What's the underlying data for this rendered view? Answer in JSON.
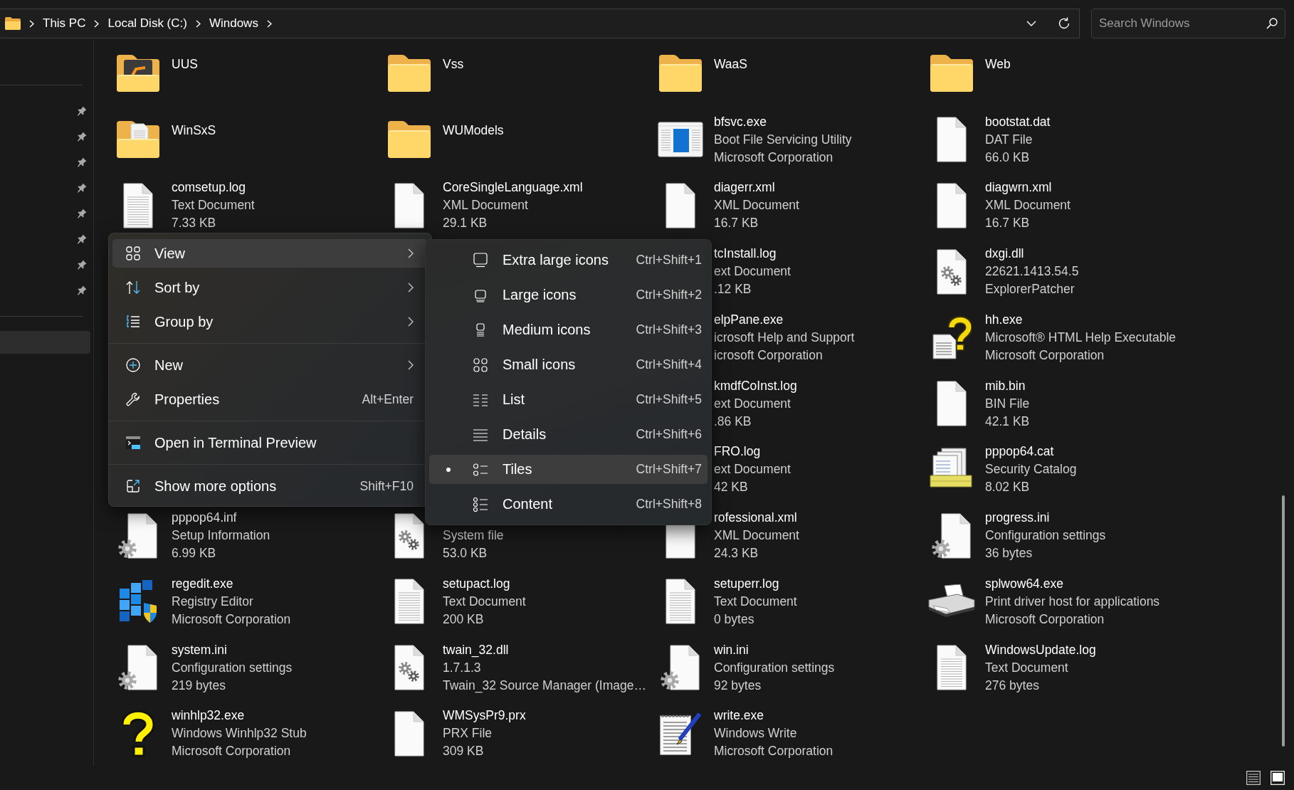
{
  "address_bar": {
    "segments": [
      "This PC",
      "Local Disk (C:)",
      "Windows"
    ]
  },
  "search": {
    "placeholder": "Search Windows"
  },
  "sidebar": {
    "sections": [
      {
        "items": [
          {
            "pinned": true,
            "selected": false
          },
          {
            "pinned": true,
            "selected": false
          },
          {
            "pinned": true,
            "selected": false
          },
          {
            "pinned": true,
            "selected": false
          },
          {
            "pinned": true,
            "selected": false
          },
          {
            "pinned": true,
            "selected": false
          },
          {
            "pinned": true,
            "selected": false
          },
          {
            "pinned": true,
            "selected": false
          }
        ]
      },
      {
        "items": [
          {
            "pinned": false,
            "selected": true
          }
        ]
      }
    ]
  },
  "files": [
    {
      "kind": "appfolder",
      "name": "UUS"
    },
    {
      "kind": "folder",
      "name": "Vss"
    },
    {
      "kind": "folder",
      "name": "WaaS"
    },
    {
      "kind": "folder",
      "name": "Web"
    },
    {
      "kind": "pagefolder",
      "name": "WinSxS"
    },
    {
      "kind": "folder",
      "name": "WUModels"
    },
    {
      "kind": "window",
      "name": "bfsvc.exe",
      "description": "Boot File Servicing Utility",
      "detail": "Microsoft Corporation"
    },
    {
      "kind": "blank",
      "name": "bootstat.dat",
      "description": "DAT File",
      "detail": "66.0 KB"
    },
    {
      "kind": "text",
      "name": "comsetup.log",
      "description": "Text Document",
      "detail": "7.33 KB"
    },
    {
      "kind": "blank",
      "name": "CoreSingleLanguage.xml",
      "description": "XML Document",
      "detail": "29.1 KB"
    },
    {
      "kind": "blank",
      "name": "diagerr.xml",
      "description": "XML Document",
      "detail": "16.7 KB"
    },
    {
      "kind": "blank",
      "name": "diagwrn.xml",
      "description": "XML Document",
      "detail": "16.7 KB"
    },
    {
      "kind": "covered",
      "name": "tcInstall.log",
      "description": "ext Document",
      "detail": ".12 KB"
    },
    {
      "kind": "library",
      "name": "dxgi.dll",
      "description": "22621.1413.54.5",
      "detail": "ExplorerPatcher"
    },
    {
      "kind": "covered",
      "name": "elpPane.exe",
      "description": "icrosoft Help and Support",
      "detail": "icrosoft Corporation"
    },
    {
      "kind": "help",
      "name": "hh.exe",
      "description": "Microsoft® HTML Help Executable",
      "detail": "Microsoft Corporation"
    },
    {
      "kind": "covered",
      "name": "kmdfCoInst.log",
      "description": "ext Document",
      "detail": ".86 KB"
    },
    {
      "kind": "blank",
      "name": "mib.bin",
      "description": "BIN File",
      "detail": "42.1 KB"
    },
    {
      "kind": "covered",
      "name": "FRO.log",
      "description": "ext Document",
      "detail": "42 KB"
    },
    {
      "kind": "catalog",
      "name": "pppop64.cat",
      "description": "Security Catalog",
      "detail": "8.02 KB"
    },
    {
      "kind": "settings",
      "name": "pppop64.inf",
      "description": "Setup Information",
      "detail": "6.99 KB"
    },
    {
      "kind": "library",
      "description": "System file",
      "detail": "53.0 KB"
    },
    {
      "kind": "blank",
      "name": "rofessional.xml",
      "description": "XML Document",
      "detail": "24.3 KB"
    },
    {
      "kind": "settings",
      "name": "progress.ini",
      "description": "Configuration settings",
      "detail": "36 bytes"
    },
    {
      "kind": "registry",
      "name": "regedit.exe",
      "description": "Registry Editor",
      "detail": "Microsoft Corporation"
    },
    {
      "kind": "text",
      "name": "setupact.log",
      "description": "Text Document",
      "detail": "200 KB"
    },
    {
      "kind": "text",
      "name": "setuperr.log",
      "description": "Text Document",
      "detail": "0 bytes"
    },
    {
      "kind": "printer",
      "name": "splwow64.exe",
      "description": "Print driver host for applications",
      "detail": "Microsoft Corporation"
    },
    {
      "kind": "settings",
      "name": "system.ini",
      "description": "Configuration settings",
      "detail": "219 bytes"
    },
    {
      "kind": "library",
      "name": "twain_32.dll",
      "description": "1.7.1.3",
      "detail": "Twain_32 Source Manager (Image…"
    },
    {
      "kind": "settings",
      "name": "win.ini",
      "description": "Configuration settings",
      "detail": "92 bytes"
    },
    {
      "kind": "text",
      "name": "WindowsUpdate.log",
      "description": "Text Document",
      "detail": "276 bytes"
    },
    {
      "kind": "question",
      "name": "winhlp32.exe",
      "description": "Windows Winhlp32 Stub",
      "detail": "Microsoft Corporation"
    },
    {
      "kind": "blank",
      "name": "WMSysPr9.prx",
      "description": "PRX File",
      "detail": "309 KB"
    },
    {
      "kind": "notepad",
      "name": "write.exe",
      "description": "Windows Write",
      "detail": "Microsoft Corporation"
    }
  ],
  "context_menu": {
    "items": [
      {
        "kind": "item",
        "label": "View",
        "submenu": true,
        "highlighted": true
      },
      {
        "kind": "item",
        "label": "Sort by",
        "submenu": true,
        "highlighted": false
      },
      {
        "kind": "item",
        "label": "Group by",
        "submenu": true,
        "highlighted": false
      },
      {
        "kind": "separator"
      },
      {
        "kind": "item",
        "label": "New",
        "submenu": true,
        "highlighted": false
      },
      {
        "kind": "item",
        "label": "Properties",
        "submenu": false,
        "shortcut": "Alt+Enter",
        "highlighted": false
      },
      {
        "kind": "separator"
      },
      {
        "kind": "item",
        "label": "Open in Terminal Preview",
        "submenu": false,
        "highlighted": false
      },
      {
        "kind": "separator"
      },
      {
        "kind": "item",
        "label": "Show more options",
        "submenu": false,
        "shortcut": "Shift+F10",
        "highlighted": false
      }
    ]
  },
  "view_submenu": {
    "items": [
      {
        "label": "Extra large icons",
        "shortcut": "Ctrl+Shift+1",
        "selected": false,
        "highlighted": false
      },
      {
        "label": "Large icons",
        "shortcut": "Ctrl+Shift+2",
        "selected": false,
        "highlighted": false
      },
      {
        "label": "Medium icons",
        "shortcut": "Ctrl+Shift+3",
        "selected": false,
        "highlighted": false
      },
      {
        "label": "Small icons",
        "shortcut": "Ctrl+Shift+4",
        "selected": false,
        "highlighted": false
      },
      {
        "label": "List",
        "shortcut": "Ctrl+Shift+5",
        "selected": false,
        "highlighted": false
      },
      {
        "label": "Details",
        "shortcut": "Ctrl+Shift+6",
        "selected": false,
        "highlighted": false
      },
      {
        "label": "Tiles",
        "shortcut": "Ctrl+Shift+7",
        "selected": true,
        "highlighted": true
      },
      {
        "label": "Content",
        "shortcut": "Ctrl+Shift+8",
        "selected": false,
        "highlighted": false
      }
    ]
  }
}
